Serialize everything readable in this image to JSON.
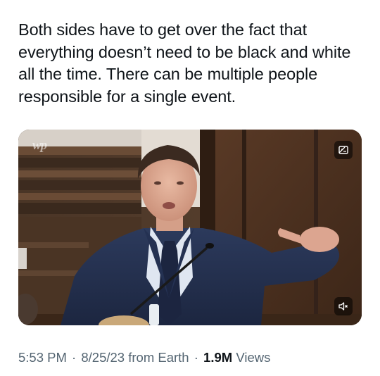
{
  "tweet": {
    "text": "Both sides have to get over the fact that everything doesn’t need to be black and white all the time. There can be multiple people responsible for a single event."
  },
  "media": {
    "watermark": "wp",
    "alt_icon": "image-gallery-icon",
    "mute_icon": "speaker-muted-icon"
  },
  "meta": {
    "time": "5:53 PM",
    "separator": "·",
    "date": "8/25/23",
    "source": "from Earth",
    "views_count": "1.9M",
    "views_label": "Views"
  },
  "colors": {
    "text_primary": "#0f1419",
    "text_secondary": "#536471",
    "background": "#ffffff"
  }
}
